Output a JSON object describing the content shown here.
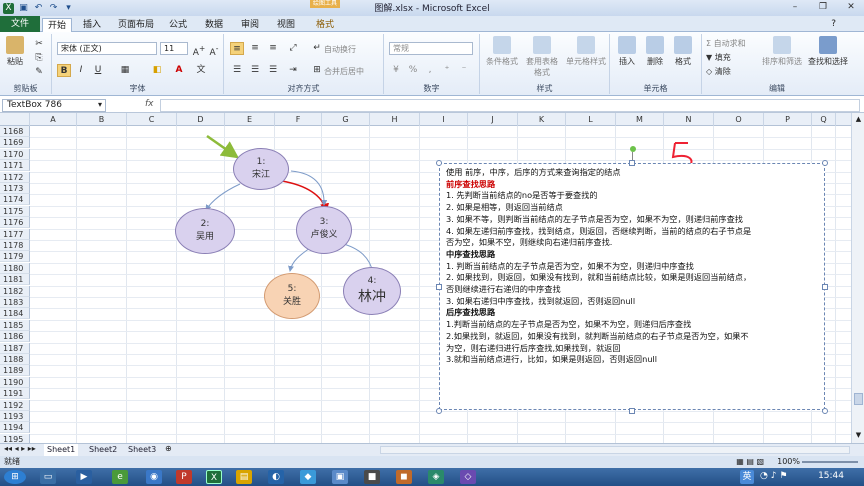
{
  "window": {
    "title": "图解.xlsx - Microsoft Excel",
    "context_tab": "绘图工具"
  },
  "tabs": {
    "file": "文件",
    "home": "开始",
    "insert": "插入",
    "page_layout": "页面布局",
    "formulas": "公式",
    "data": "数据",
    "review": "审阅",
    "view": "视图",
    "format": "格式"
  },
  "ribbon": {
    "clipboard": {
      "label": "剪贴板",
      "paste": "粘贴"
    },
    "font": {
      "label": "字体",
      "name": "宋体 (正文)",
      "size": "11",
      "bold": "B",
      "italic": "I",
      "underline": "U"
    },
    "alignment": {
      "label": "对齐方式",
      "wrap": "自动换行",
      "merge": "合并后居中"
    },
    "number": {
      "label": "数字",
      "format": "常规"
    },
    "styles": {
      "label": "样式",
      "conditional": "条件格式",
      "table": "套用表格格式",
      "cell_styles": "单元格样式"
    },
    "cells": {
      "label": "单元格",
      "insert": "插入",
      "delete": "删除",
      "format": "格式"
    },
    "editing": {
      "label": "编辑",
      "autosum": "自动求和",
      "fill": "填充",
      "clear": "清除",
      "sort": "排序和筛选",
      "find": "查找和选择"
    }
  },
  "formula": {
    "namebox": "TextBox 786",
    "fx": "fx"
  },
  "columns": [
    "A",
    "B",
    "C",
    "D",
    "E",
    "F",
    "G",
    "H",
    "I",
    "J",
    "K",
    "L",
    "M",
    "N",
    "O",
    "P",
    "Q"
  ],
  "rows": [
    "1168",
    "1169",
    "1170",
    "1171",
    "1172",
    "1173",
    "1174",
    "1175",
    "1176",
    "1177",
    "1178",
    "1179",
    "1180",
    "1181",
    "1182",
    "1183",
    "1184",
    "1185",
    "1186",
    "1187",
    "1188",
    "1189",
    "1190",
    "1191",
    "1192",
    "1193",
    "1194",
    "1195"
  ],
  "tree": {
    "n1": {
      "num": "1:",
      "name": "宋江"
    },
    "n2": {
      "num": "2:",
      "name": "吴用"
    },
    "n3": {
      "num": "3:",
      "name": "卢俊义"
    },
    "n4": {
      "num": "4:",
      "name": "林冲"
    },
    "n5": {
      "num": "5:",
      "name": "关胜"
    }
  },
  "annotation": {
    "five": "5"
  },
  "textbox": {
    "lines": [
      "使用 前序，中序，后序的方式来查询指定的结点",
      "前序查找思路",
      "1. 先判断当前结点的no是否等于要查找的",
      "2. 如果是相等，则返回当前结点",
      "3. 如果不等，则判断当前结点的左子节点是否为空，如果不为空，则递归前序查找",
      "4. 如果左递归前序查找，找到结点，则返回，否继续判断，当前的结点的右子节点是",
      "否为空，如果不空，则继续向右递归前序查找.",
      "中序查找思路",
      "1. 判断当前结点的左子节点是否为空，如果不为空，则递归中序查找",
      "2. 如果找到，则返回，如果没有找到，就和当前结点比较，如果是则返回当前结点，",
      "否则继续进行右递归的中序查找",
      "3. 如果右递归中序查找，找到就返回，否则返回null",
      "后序查找思路",
      "1.判断当前结点的左子节点是否为空，如果不为空，则递归后序查找",
      "2.如果找到，就返回，如果没有找到，就判断当前结点的右子节点是否为空，如果不",
      "为空，则右递归进行后序查找,如果找到，就返回",
      "3.就和当前结点进行，比如，如果是则返回，否则返回null"
    ]
  },
  "sheets": [
    "Sheet1",
    "Sheet2",
    "Sheet3"
  ],
  "status": {
    "ready": "就绪",
    "zoom": "100%"
  },
  "taskbar": {
    "clock": "15:44",
    "ime": "英"
  }
}
